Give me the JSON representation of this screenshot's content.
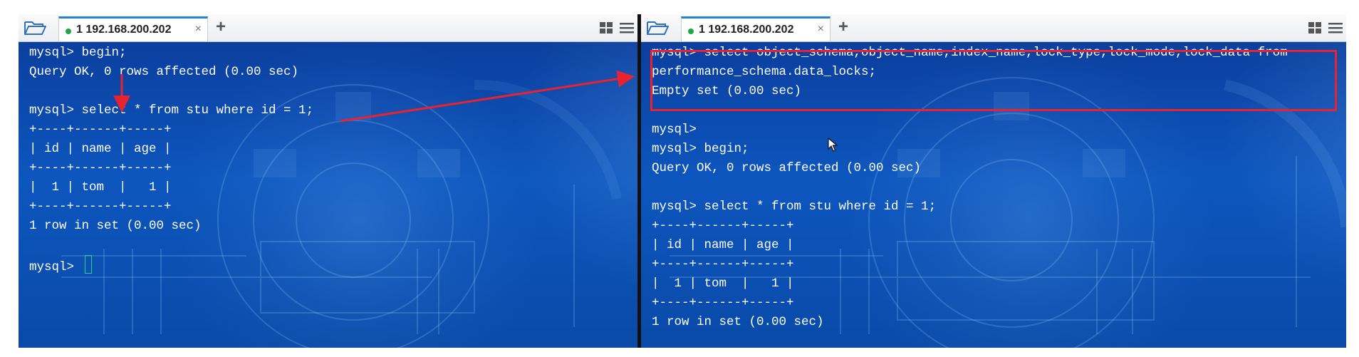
{
  "left_pane": {
    "tab": {
      "number": "1",
      "host": "192.168.200.202",
      "label": "1 192.168.200.202",
      "status_color": "#22a745"
    },
    "close_symbol": "×",
    "add_symbol": "+",
    "icons": [
      "folder-open-icon",
      "grid-view-icon",
      "menu-icon"
    ],
    "lines": [
      "mysql> begin;",
      "Query OK, 0 rows affected (0.00 sec)",
      "",
      "mysql> select * from stu where id = 1;",
      "+----+------+-----+",
      "| id | name | age |",
      "+----+------+-----+",
      "|  1 | tom  |   1 |",
      "+----+------+-----+",
      "1 row in set (0.00 sec)",
      "",
      "mysql> "
    ]
  },
  "right_pane": {
    "tab": {
      "number": "1",
      "host": "192.168.200.202",
      "label": "1 192.168.200.202",
      "status_color": "#22a745"
    },
    "close_symbol": "×",
    "add_symbol": "+",
    "icons": [
      "folder-open-icon",
      "grid-view-icon",
      "menu-icon"
    ],
    "lines": [
      "mysql> select object_schema,object_name,index_name,lock_type,lock_mode,lock_data from",
      "performance_schema.data_locks;",
      "Empty set (0.00 sec)",
      "",
      "mysql>",
      "mysql> begin;",
      "Query OK, 0 rows affected (0.00 sec)",
      "",
      "mysql> select * from stu where id = 1;",
      "+----+------+-----+",
      "| id | name | age |",
      "+----+------+-----+",
      "|  1 | tom  |   1 |",
      "+----+------+-----+",
      "1 row in set (0.00 sec)"
    ]
  },
  "colors": {
    "annotation": "#e8232f",
    "terminal_bg": "#0d56be",
    "terminal_text": "#ffffff",
    "cursor": "#21d38a",
    "active_tab_accent": "#2a7fd4"
  }
}
